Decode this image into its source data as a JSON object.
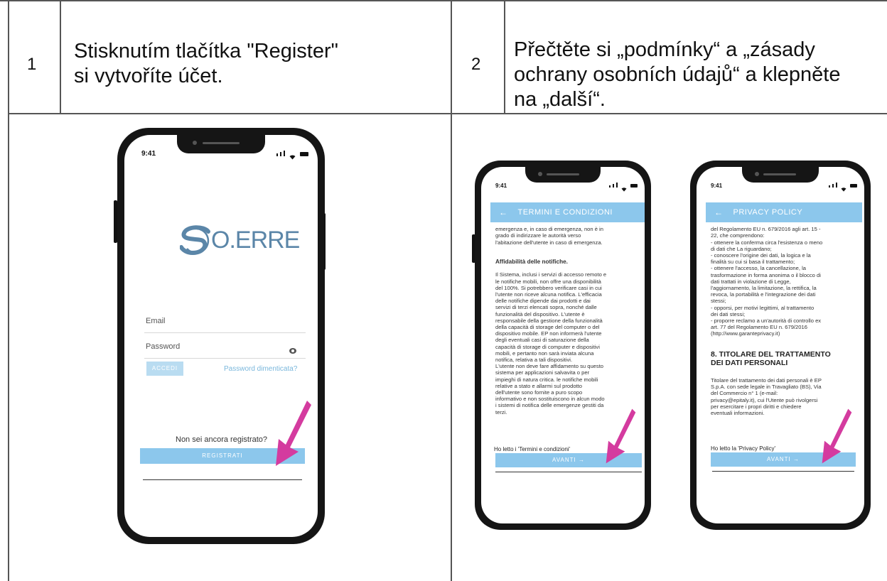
{
  "steps": [
    {
      "number": "1",
      "lines": [
        "Stisknutím tlačítka \"Register\"",
        "si vytvoříte účet."
      ]
    },
    {
      "number": "2",
      "lines": [
        "Přečtěte si „podmínky“ a „zásady",
        "ochrany osobních údajů“ a klepněte",
        "na „další“."
      ]
    }
  ],
  "login_phone": {
    "time": "9:41",
    "logo_text": "O.ERRE",
    "email_label": "Email",
    "password_label": "Password",
    "login_button": "ACCEDI",
    "forgot_link": "Password dimenticata?",
    "not_registered": "Non sei ancora registrato?",
    "register_button": "REGISTRATI"
  },
  "terms_phone": {
    "time": "9:41",
    "header": "TERMINI E CONDIZIONI",
    "intro": "emergenza e, in caso di emergenza, non è in\ngrado di indirizzare le autorità verso\nl'abitazione dell'utente in caso di emergenza.",
    "section_title": "Affidabilità delle notifiche.",
    "body": "Il Sistema, inclusi i servizi di accesso remoto e\nle notifiche mobili, non offre una disponibilità\ndel 100%. Si potrebbero verificare casi in cui\nl'utente non riceve alcuna notifica. L'efficacia\ndelle notifiche dipende dai prodotti e dai\nservizi di terzi elencati sopra, nonché dalle\nfunzionalità del dispositivo. L'utente è\nresponsabile della gestione della funzionalità\ndella capacità di storage del computer o del\ndispositivo mobile. EP non informerà l'utente\ndegli eventuali casi di saturazione della\ncapacità di storage di computer e dispositivi\nmobili, e pertanto non sarà inviata alcuna\nnotifica, relativa a tali dispositivi.\nL'utente non deve fare affidamento su questo\nsistema per applicazioni salvavita o per\nimpieghi di natura critica. le notifiche mobili\nrelative a stato e allarmi sul prodotto\ndell'utente sono fornite a puro scopo\ninformativo e non sostituiscono in alcun modo\ni sistemi di notifica delle emergenze gestiti da\nterzi.",
    "check_label": "Ho letto i 'Termini e condizioni'",
    "next_button": "AVANTI →"
  },
  "privacy_phone": {
    "time": "9:41",
    "header": "PRIVACY POLICY",
    "body": "del Regolamento EU n. 679/2016 agli art. 15 -\n22, che comprendono:\n- ottenere la conferma circa l'esistenza o meno\ndi dati che La riguardano;\n- conoscere l'origine dei dati, la logica e la\nfinalità su cui si basa il trattamento;\n- ottenere l'accesso, la cancellazione, la\ntrasformazione in forma anonima o il blocco di\ndati trattati in violazione di Legge,\nl'aggiornamento, la limitazione, la rettifica, la\nrevoca, la portabilità e l'integrazione dei dati\nstessi;\n- opporsi, per motivi legittimi, al trattamento\ndei dati stessi;\n- proporre reclamo a un'autorità di controllo ex\nart. 77 del Regolamento EU n. 679/2016\n(http://www.garanteprivacy.it)",
    "section_title": "8. TITOLARE DEL TRATTAMENTO\nDEI DATI PERSONALI",
    "section_body": "Titolare del trattamento dei dati personali è EP\nS.p.A. con sede legale in Travagliato (BS), Via\ndel Commercio n° 1 (e-mail:\nprivacy@epitaly.it), cui l'Utente può rivolgersi\nper esercitare i propri diritti e chiedere\neventuali informazioni.",
    "check_label": "Ho letto la 'Privacy Policy'",
    "next_button": "AVANTI →"
  },
  "colors": {
    "accent": "#8cc7ec",
    "arrow": "#d43b9f",
    "logo": "#5b86a8"
  }
}
